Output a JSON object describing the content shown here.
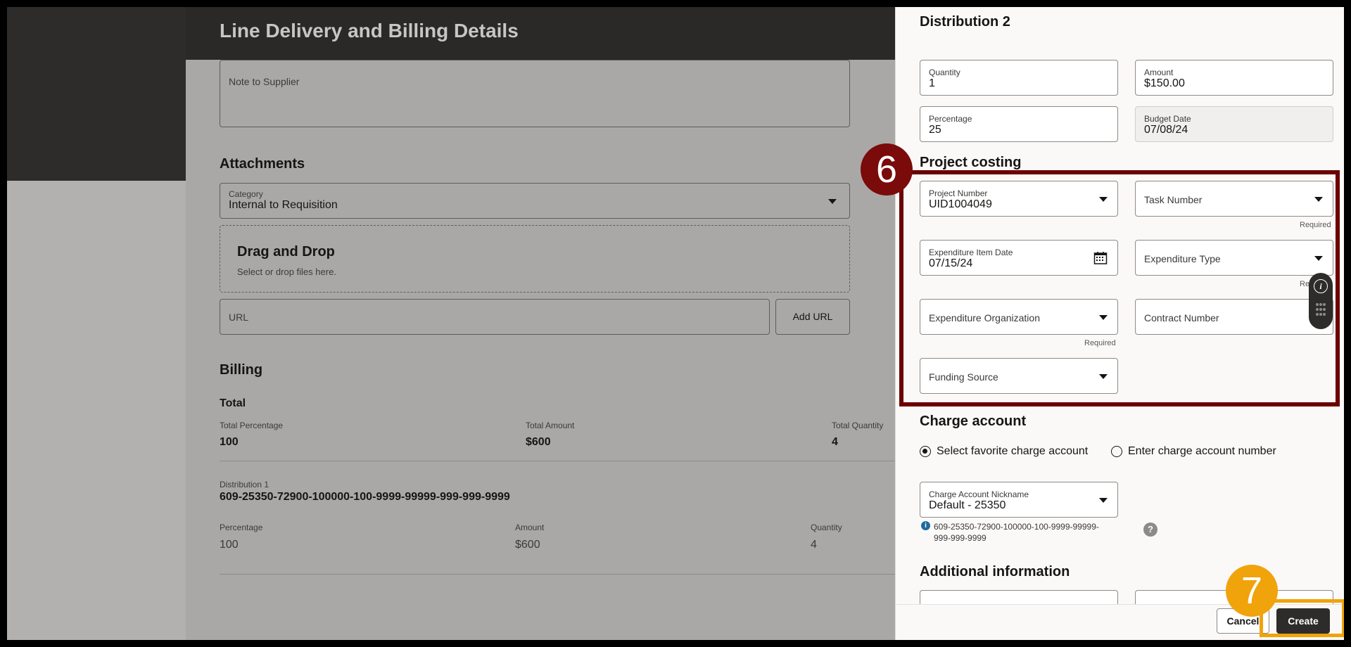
{
  "background": {
    "title": "Line Delivery and Billing Details",
    "note_label": "Note to Supplier",
    "attachments": {
      "heading": "Attachments",
      "category_label": "Category",
      "category_value": "Internal to Requisition",
      "dropzone_title": "Drag and Drop",
      "dropzone_hint": "Select or drop files here.",
      "url_placeholder": "URL",
      "add_url_label": "Add URL"
    },
    "billing": {
      "heading": "Billing",
      "total_heading": "Total",
      "totals": [
        {
          "label": "Total Percentage",
          "value": "100"
        },
        {
          "label": "Total Amount",
          "value": "$600"
        },
        {
          "label": "Total Quantity",
          "value": "4"
        }
      ],
      "distribution": {
        "label": "Distribution 1",
        "account": "609-25350-72900-100000-100-9999-99999-999-999-9999",
        "fields": [
          {
            "label": "Percentage",
            "value": "100"
          },
          {
            "label": "Amount",
            "value": "$600"
          },
          {
            "label": "Quantity",
            "value": "4"
          }
        ]
      }
    }
  },
  "panel": {
    "title": "Distribution 2",
    "quantity": {
      "label": "Quantity",
      "value": "1"
    },
    "amount": {
      "label": "Amount",
      "value": "$150.00"
    },
    "percentage": {
      "label": "Percentage",
      "value": "25"
    },
    "budget_date": {
      "label": "Budget Date",
      "value": "07/08/24"
    },
    "project_costing": {
      "heading": "Project costing",
      "project_number": {
        "label": "Project Number",
        "value": "UID1004049"
      },
      "task_number": {
        "label": "Task Number"
      },
      "expenditure_item_date": {
        "label": "Expenditure Item Date",
        "value": "07/15/24"
      },
      "expenditure_type": {
        "label": "Expenditure Type"
      },
      "expenditure_organization": {
        "label": "Expenditure Organization"
      },
      "contract_number": {
        "label": "Contract Number"
      },
      "funding_source": {
        "label": "Funding Source"
      },
      "required_text": "Required",
      "required_partial": "Requ"
    },
    "charge_account": {
      "heading": "Charge account",
      "option_favorite": "Select favorite charge account",
      "option_enter": "Enter charge account number",
      "nickname_label": "Charge Account Nickname",
      "nickname_value": "Default - 25350",
      "account_line1": "609-25350-72900-100000-100-9999-99999-",
      "account_line2": "999-999-9999"
    },
    "additional_heading": "Additional information",
    "cancel_label": "Cancel",
    "create_label": "Create"
  },
  "steps": {
    "six": "6",
    "seven": "7"
  },
  "colors": {
    "highlight": "#6b0000",
    "step6": "#7b0a0a",
    "step7": "#f0a30a",
    "create_border": "#f0a30a"
  }
}
